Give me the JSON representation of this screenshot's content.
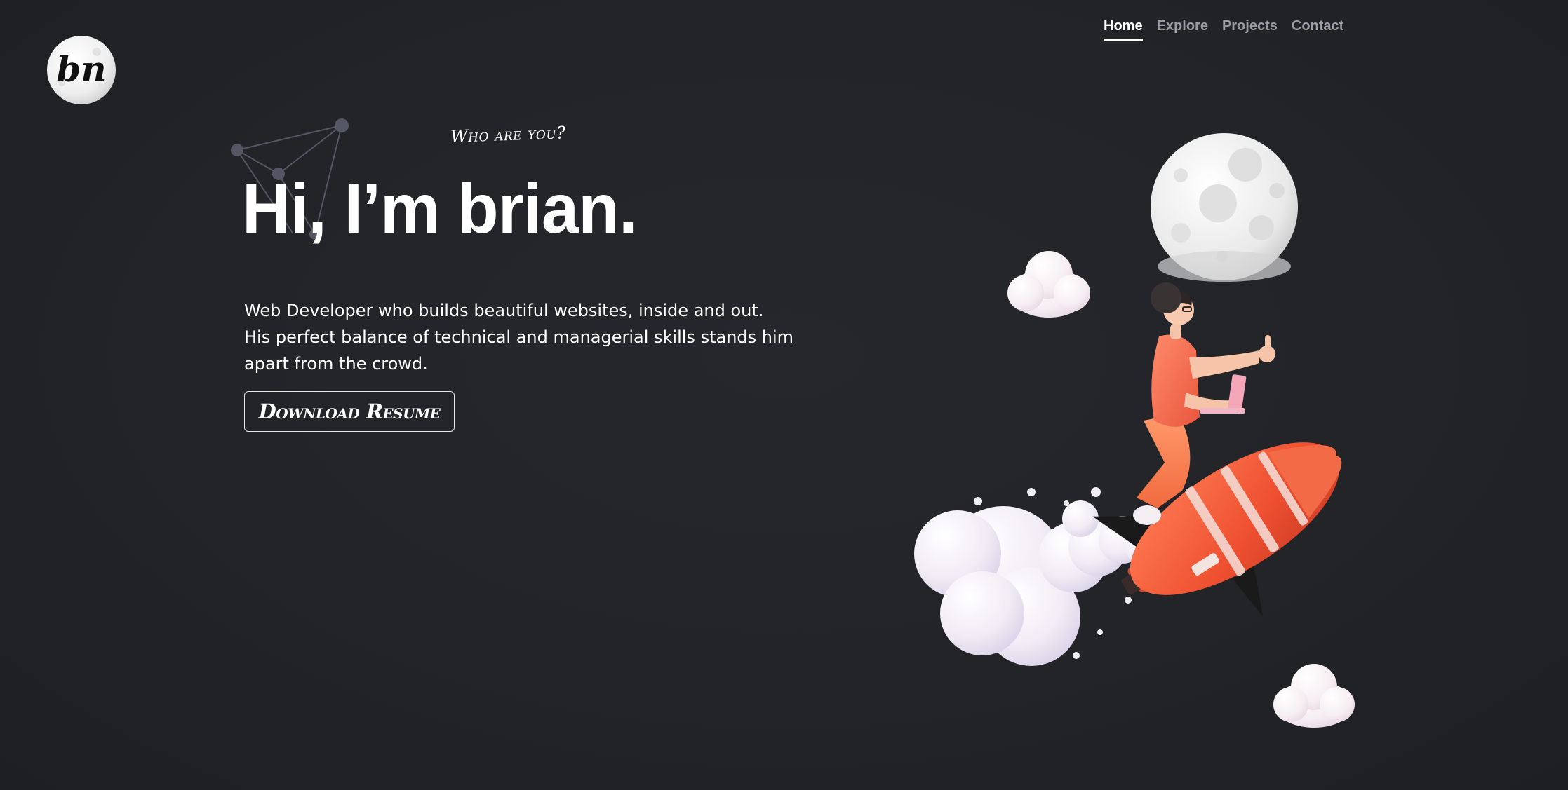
{
  "logo": {
    "text": "bn",
    "icon": "moon-logo-icon"
  },
  "nav": {
    "items": [
      {
        "label": "Home",
        "active": true
      },
      {
        "label": "Explore",
        "active": false
      },
      {
        "label": "Projects",
        "active": false
      },
      {
        "label": "Contact",
        "active": false
      }
    ]
  },
  "hero": {
    "eyebrow": "Who are you?",
    "headline": "Hi, I’m brian.",
    "bio": [
      "Web Developer who builds beautiful websites, inside and out.",
      "His perfect balance of technical and managerial skills stands him",
      "apart from the crowd."
    ],
    "resume_button": "Download Resume"
  },
  "illustration": {
    "icon": "rocket-rider-illustration",
    "colors": {
      "moon": "#ececec",
      "cloud": "#f3eef6",
      "rocket": "#ee5a35",
      "shirt": "#f27055"
    }
  },
  "colors": {
    "background": "#23252a",
    "text": "#ffffff",
    "nav_inactive": "#9a9ca3",
    "constellation": "#545763"
  }
}
